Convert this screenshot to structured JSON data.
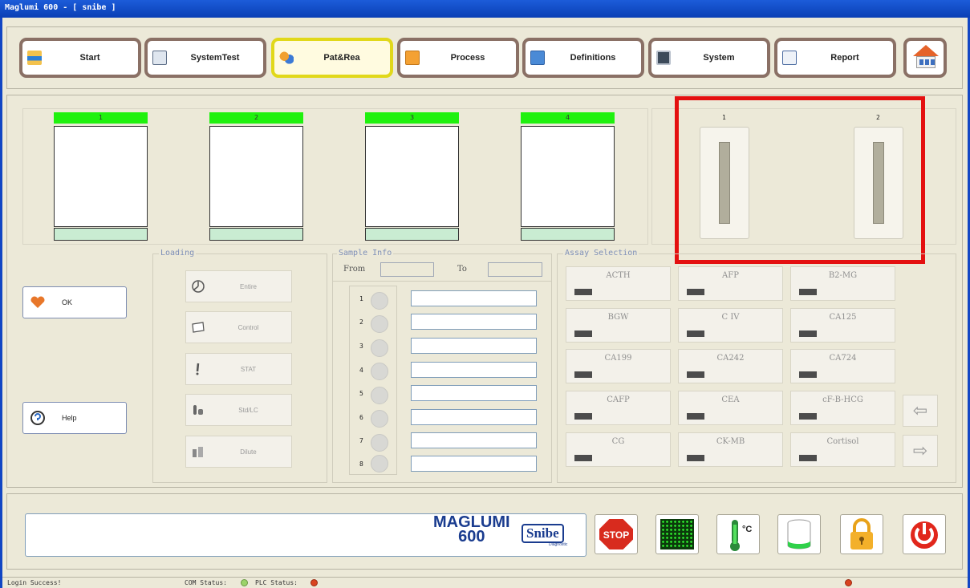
{
  "window": {
    "title": "Maglumi 600 - [ snibe ]"
  },
  "toolbar": {
    "buttons": [
      {
        "label": "Start",
        "icon": "start-icon",
        "active": false
      },
      {
        "label": "SystemTest",
        "icon": "systemtest-icon",
        "active": false
      },
      {
        "label": "Pat&Rea",
        "icon": "patients-icon",
        "active": true
      },
      {
        "label": "Process",
        "icon": "process-icon",
        "active": false
      },
      {
        "label": "Definitions",
        "icon": "definitions-icon",
        "active": false
      },
      {
        "label": "System",
        "icon": "system-icon",
        "active": false
      },
      {
        "label": "Report",
        "icon": "report-icon",
        "active": false
      }
    ],
    "home_icon": "home-icon"
  },
  "sample_racks": {
    "labels": [
      "1",
      "2",
      "3",
      "4"
    ]
  },
  "reagent_slots": {
    "labels": [
      "1",
      "2"
    ]
  },
  "side_buttons": {
    "ok": "OK",
    "help": "Help"
  },
  "loading": {
    "title": "Loading",
    "buttons": [
      "Entire",
      "Control",
      "STAT",
      "Std/LC",
      "Dilute"
    ]
  },
  "sample_info": {
    "title": "Sample Info",
    "from_label": "From",
    "to_label": "To",
    "from_value": "",
    "to_value": "",
    "positions": [
      "1",
      "2",
      "3",
      "4",
      "5",
      "6",
      "7",
      "8"
    ]
  },
  "assay_selection": {
    "title": "Assay Selection",
    "assays": [
      "ACTH",
      "AFP",
      "B2-MG",
      "BGW",
      "C IV",
      "CA125",
      "CA199",
      "CA242",
      "CA724",
      "CAFP",
      "CEA",
      "cF-B-HCG",
      "CG",
      "CK-MB",
      "Cortisol"
    ]
  },
  "bottom": {
    "brand_line1": "MAGLUMI",
    "brand_line2": "600",
    "brand_logo": "Snibe",
    "brand_sub": "Diagnostic",
    "stop_label": "STOP",
    "temp_unit": "°C"
  },
  "statusbar": {
    "message": "Login Success!",
    "com_status_label": "COM Status:",
    "plc_status_label": "PLC Status:"
  },
  "colors": {
    "rack_header": "#1ff10e",
    "highlight": "#e41010",
    "active_tab_border": "#e1d81a",
    "com_led": "#9bd36a",
    "plc_led": "#d9431f"
  }
}
